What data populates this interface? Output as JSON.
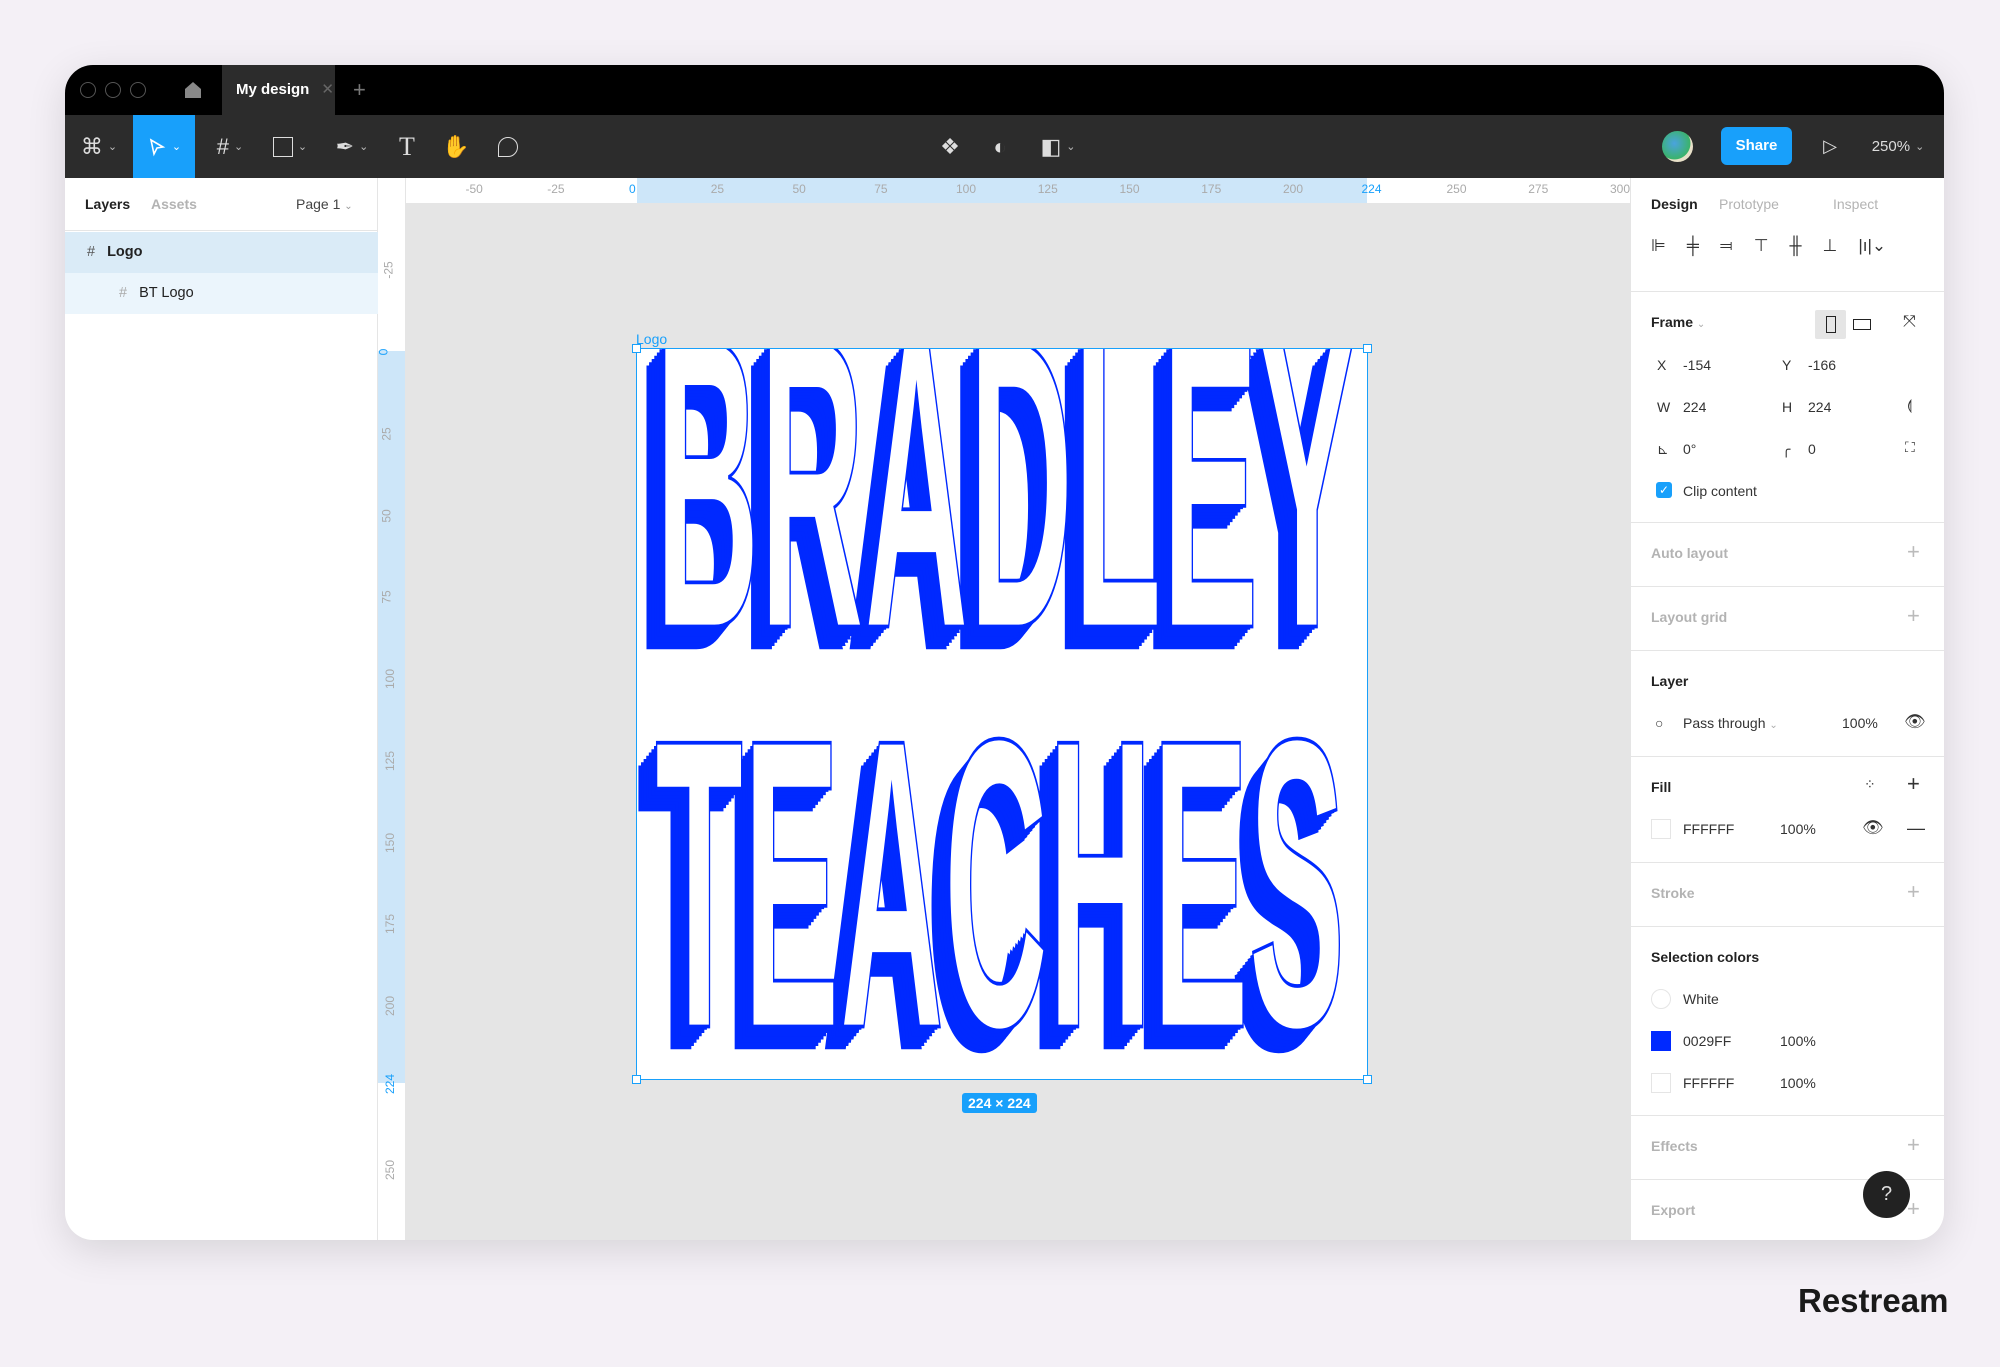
{
  "window": {
    "tab_title": "My design",
    "new_tab": "+"
  },
  "toolbar": {
    "share_label": "Share",
    "zoom": "250%",
    "accent": "#18a0fb"
  },
  "layers_panel": {
    "tabs": [
      "Layers",
      "Assets"
    ],
    "page": "Page 1",
    "items": [
      {
        "name": "Logo",
        "selected": true
      },
      {
        "name": "BT Logo",
        "selected": false
      }
    ]
  },
  "rulers": {
    "horizontal": [
      "-50",
      "-25",
      "0",
      "25",
      "50",
      "75",
      "100",
      "125",
      "150",
      "175",
      "200",
      "224",
      "250",
      "275",
      "300"
    ],
    "vertical": [
      "-25",
      "0",
      "25",
      "50",
      "75",
      "100",
      "125",
      "150",
      "175",
      "200",
      "224",
      "250"
    ]
  },
  "canvas": {
    "frame_label": "Logo",
    "size_badge": "224 × 224",
    "logo_lines": [
      "BRADLEY",
      "TEACHES"
    ],
    "logo_color": "#0029FF"
  },
  "design_panel": {
    "tabs": [
      "Design",
      "Prototype",
      "Inspect"
    ],
    "frame": {
      "title": "Frame",
      "x_label": "X",
      "x": "-154",
      "y_label": "Y",
      "y": "-166",
      "w_label": "W",
      "w": "224",
      "h_label": "H",
      "h": "224",
      "rotation": "0°",
      "radius": "0",
      "clip_label": "Clip content",
      "clip": true
    },
    "auto_layout": "Auto layout",
    "layout_grid": "Layout grid",
    "layer": {
      "title": "Layer",
      "blend": "Pass through",
      "opacity": "100%"
    },
    "fill": {
      "title": "Fill",
      "hex": "FFFFFF",
      "opacity": "100%"
    },
    "stroke": "Stroke",
    "selection_colors": {
      "title": "Selection colors",
      "items": [
        {
          "name": "White",
          "color": "#FFFFFF"
        },
        {
          "name": "0029FF",
          "opacity": "100%",
          "color": "#0029FF"
        },
        {
          "name": "FFFFFF",
          "opacity": "100%",
          "color": "#FFFFFF"
        }
      ]
    },
    "effects": "Effects",
    "export": "Export"
  },
  "help": "?",
  "watermark": "Restream"
}
